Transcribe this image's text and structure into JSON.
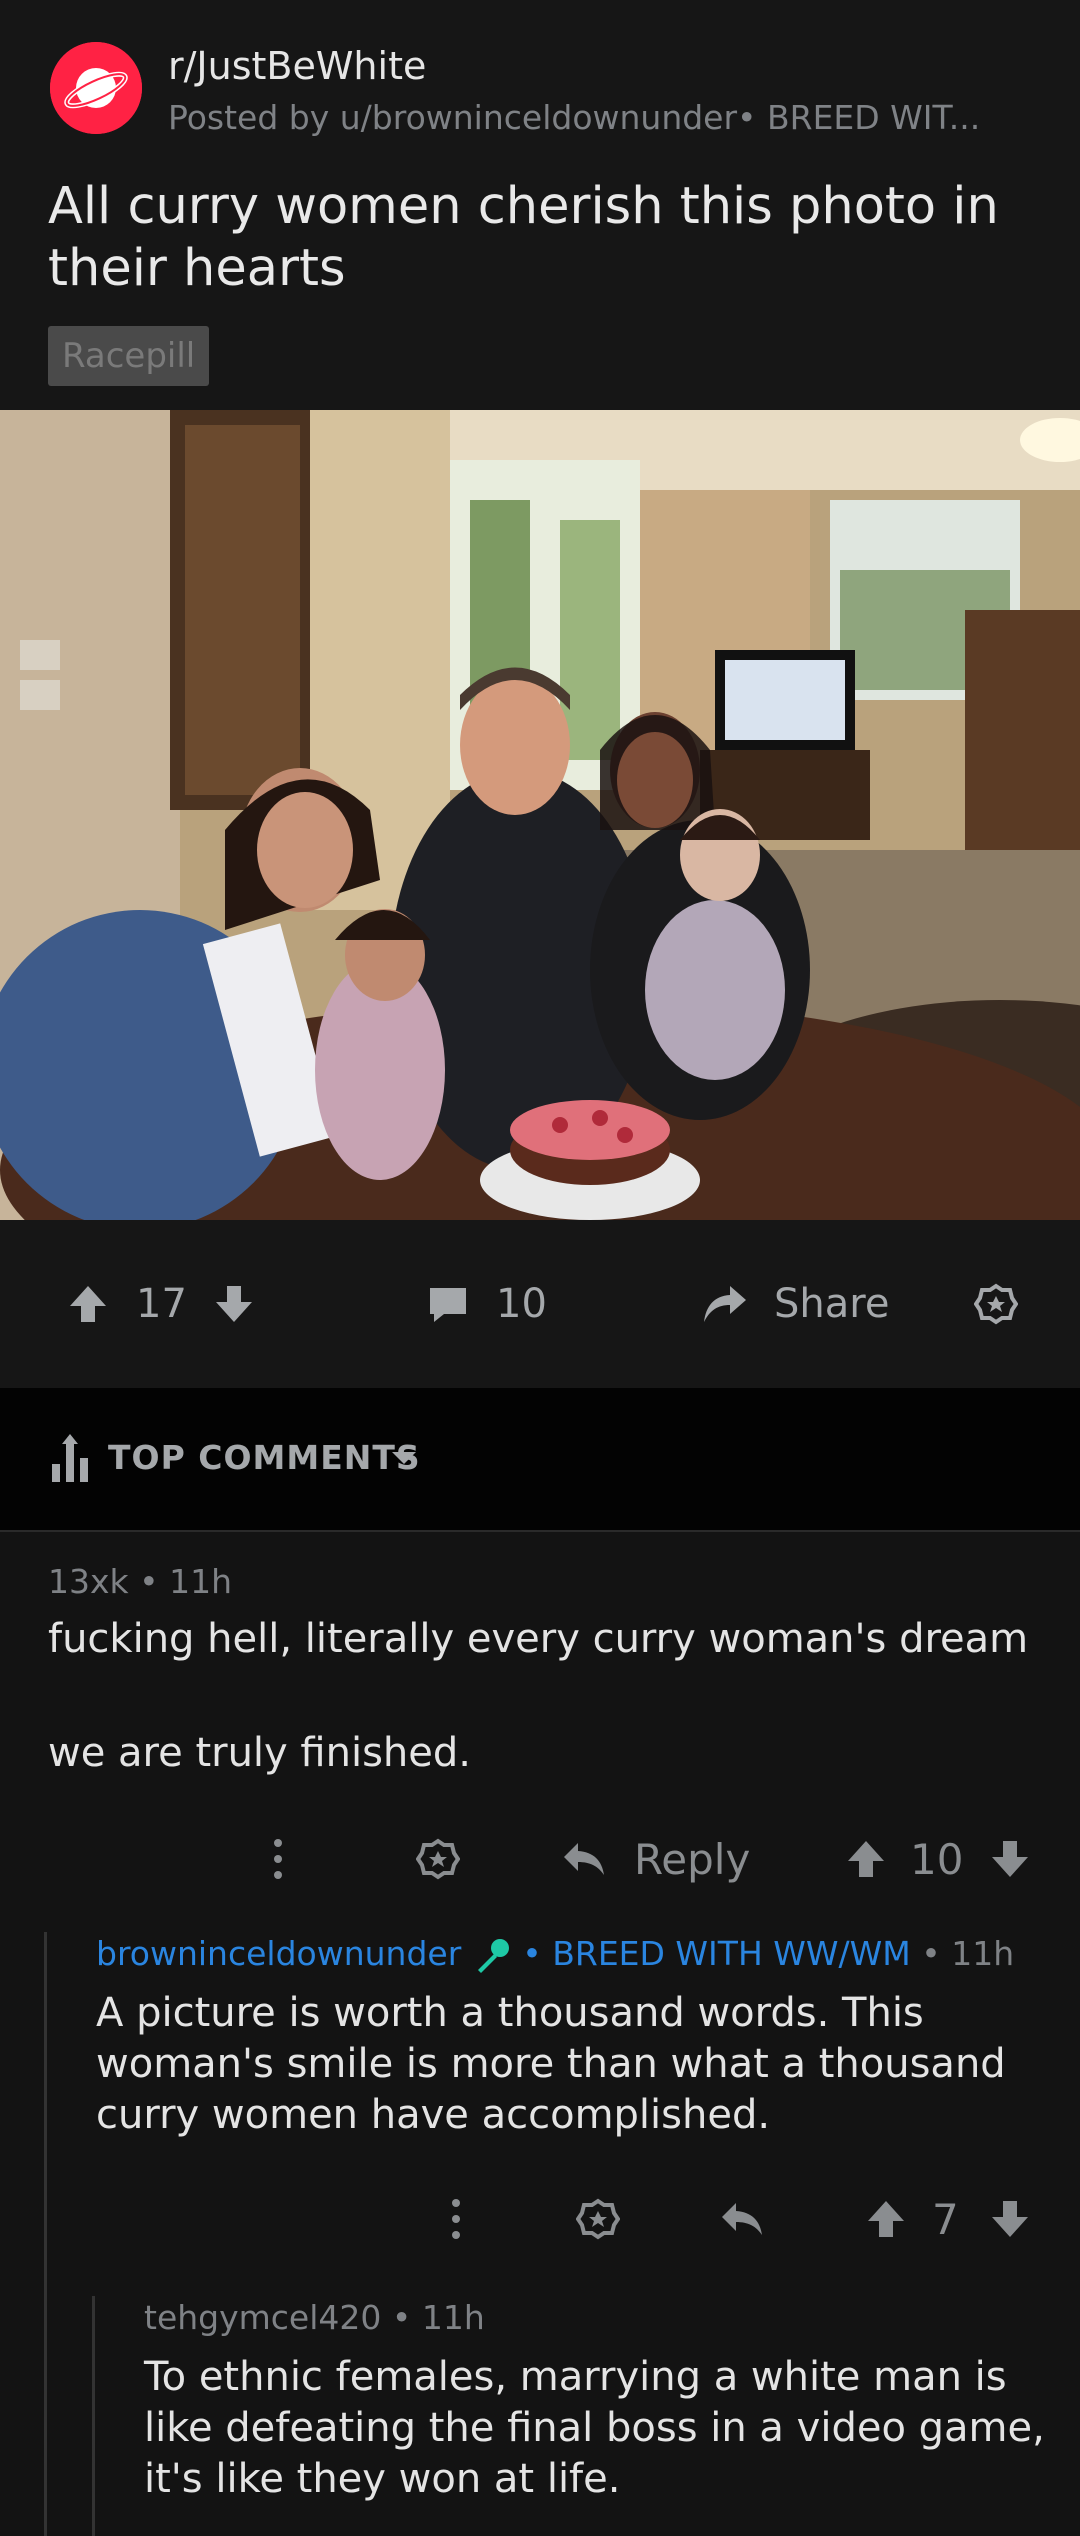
{
  "post": {
    "subreddit": "r/JustBeWhite",
    "meta": "Posted by u/browninceldownunder• BREED WIT...",
    "title": "All curry women cherish this photo in their hearts",
    "flair": "Racepill"
  },
  "actions": {
    "upvotes": "17",
    "comments": "10",
    "share": "Share"
  },
  "comments_header": {
    "label": "TOP COMMENTS"
  },
  "comments": [
    {
      "author": "13xk",
      "time": "11h",
      "body_line1": "fucking hell, literally every curry woman's dream",
      "body_line2": "we are truly finished.",
      "reply_label": "Reply",
      "score": "10"
    },
    {
      "author": "browninceldownunder",
      "flair": "BREED WITH WW/WM",
      "time": "11h",
      "body": "A picture is worth a thousand words. This woman's smile is more than what a thousand curry women have accomplished.",
      "score": "7"
    },
    {
      "author": "tehgymcel420",
      "time": "11h",
      "body": "To ethnic females, marrying a white man is like defeating the final boss in a video game, it's like they won at life."
    }
  ],
  "colors": {
    "background": "#131313",
    "subreddit_icon": "#ff2244",
    "flair_blue": "#2a85e0",
    "mic_icon": "#1ec9a6"
  }
}
